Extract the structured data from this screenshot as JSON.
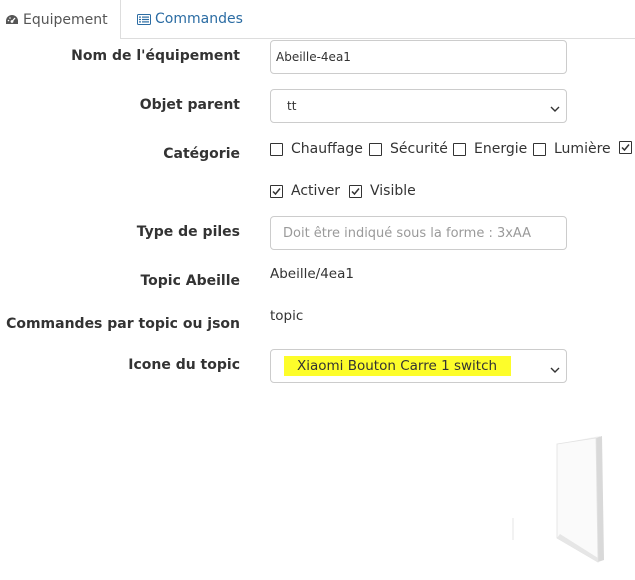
{
  "tabs": [
    {
      "label": "Equipement",
      "icon": "tachometer-icon",
      "active": true
    },
    {
      "label": "Commandes",
      "icon": "list-icon",
      "active": false
    }
  ],
  "form": {
    "nom": {
      "label": "Nom de l'équipement",
      "value": "Abeille-4ea1"
    },
    "objet_parent": {
      "label": "Objet parent",
      "value": "tt"
    },
    "categorie": {
      "label": "Catégorie",
      "options": [
        {
          "label": "Chauffage",
          "checked": false
        },
        {
          "label": "Sécurité",
          "checked": false
        },
        {
          "label": "Energie",
          "checked": false
        },
        {
          "label": "Lumière",
          "checked": false
        }
      ]
    },
    "etat": [
      {
        "label": "Activer",
        "checked": true
      },
      {
        "label": "Visible",
        "checked": true
      }
    ],
    "type_piles": {
      "label": "Type de piles",
      "placeholder": "Doit être indiqué sous la forme : 3xAA"
    },
    "topic": {
      "label": "Topic Abeille",
      "value": "Abeille/4ea1"
    },
    "commandes_topic": {
      "label": "Commandes par topic ou json",
      "value": "topic"
    },
    "icone_topic": {
      "label": "Icone du topic",
      "value": "Xiaomi Bouton Carre 1 switch",
      "highlight_color": "#fdfd2a"
    }
  },
  "colors": {
    "link": "#2b6ca3",
    "border": "#cccccc"
  }
}
